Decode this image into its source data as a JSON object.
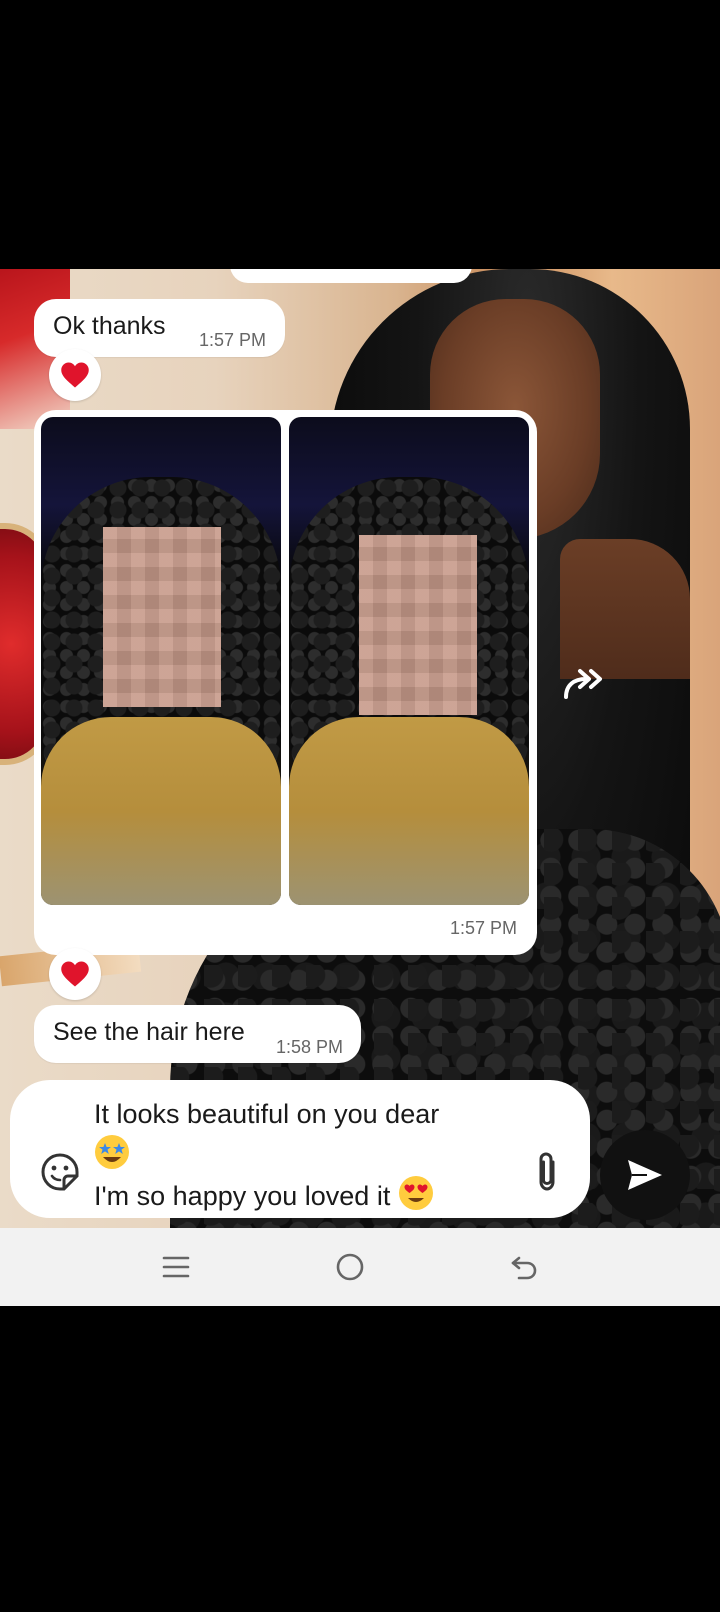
{
  "messages": [
    {
      "text": "Ok thanks",
      "time": "1:57 PM",
      "reaction": "heart"
    },
    {
      "type": "media",
      "time": "1:57 PM",
      "reaction": "heart"
    },
    {
      "text": "See the hair here",
      "time": "1:58 PM"
    }
  ],
  "composer": {
    "line1": "It looks beautiful on you dear",
    "line3": "I'm so happy you loved it"
  },
  "icons": {
    "reaction": "heart-icon",
    "forward": "forward-icon",
    "sticker": "sticker-icon",
    "attach": "paperclip-icon",
    "send": "send-icon",
    "nav": [
      "recent-apps-icon",
      "home-icon",
      "back-icon"
    ]
  },
  "colors": {
    "bubble": "#ffffff",
    "heart": "#e0142c",
    "send": "#111111",
    "navbar": "#f2f2f2"
  }
}
